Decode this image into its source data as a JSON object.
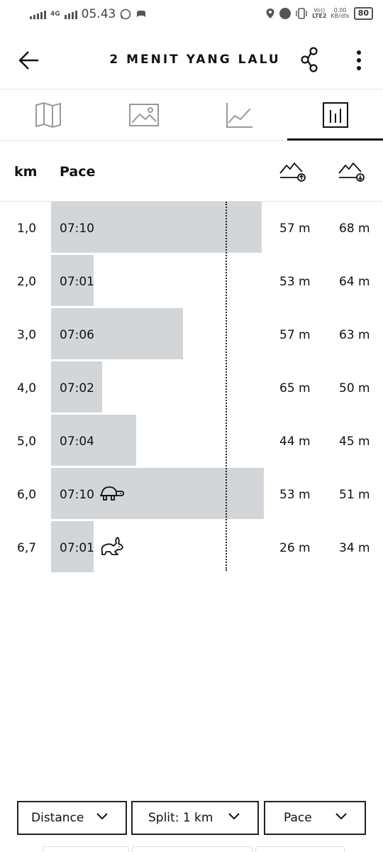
{
  "status_bar": {
    "network": "4G",
    "time": "05.43",
    "carrier_line1": "Vo))",
    "carrier_line2": "LTE2",
    "speed_value": "0.00",
    "speed_unit": "KB/dtk",
    "battery": "80"
  },
  "header": {
    "title": "2 MENIT YANG LALU"
  },
  "tabs": [
    {
      "icon": "map-icon",
      "active": false
    },
    {
      "icon": "image-icon",
      "active": false
    },
    {
      "icon": "line-chart-icon",
      "active": false
    },
    {
      "icon": "bar-chart-icon",
      "active": true
    }
  ],
  "table": {
    "col_km": "km",
    "col_pace": "Pace",
    "col_ascent_icon": "ascent-icon",
    "col_descent_icon": "descent-icon",
    "rows": [
      {
        "km": "1,0",
        "pace": "07:10",
        "ascent": "57 m",
        "descent": "68 m",
        "marker": ""
      },
      {
        "km": "2,0",
        "pace": "07:01",
        "ascent": "53 m",
        "descent": "64 m",
        "marker": ""
      },
      {
        "km": "3,0",
        "pace": "07:06",
        "ascent": "57 m",
        "descent": "63 m",
        "marker": ""
      },
      {
        "km": "4,0",
        "pace": "07:02",
        "ascent": "65 m",
        "descent": "50 m",
        "marker": ""
      },
      {
        "km": "5,0",
        "pace": "07:04",
        "ascent": "44 m",
        "descent": "45 m",
        "marker": ""
      },
      {
        "km": "6,0",
        "pace": "07:10",
        "ascent": "53 m",
        "descent": "51 m",
        "marker": "turtle-icon"
      },
      {
        "km": "6,7",
        "pace": "07:01",
        "ascent": "26 m",
        "descent": "34 m",
        "marker": "rabbit-icon"
      }
    ]
  },
  "bar_fill_fraction": [
    0.99,
    0.2,
    0.62,
    0.24,
    0.4,
    1.0,
    0.2
  ],
  "average_line_fraction": 0.82,
  "dropdowns": {
    "distance": "Distance",
    "split": "Split: 1 km",
    "pace": "Pace"
  },
  "colors": {
    "bar": "#d3d6d9",
    "text": "#111111"
  }
}
